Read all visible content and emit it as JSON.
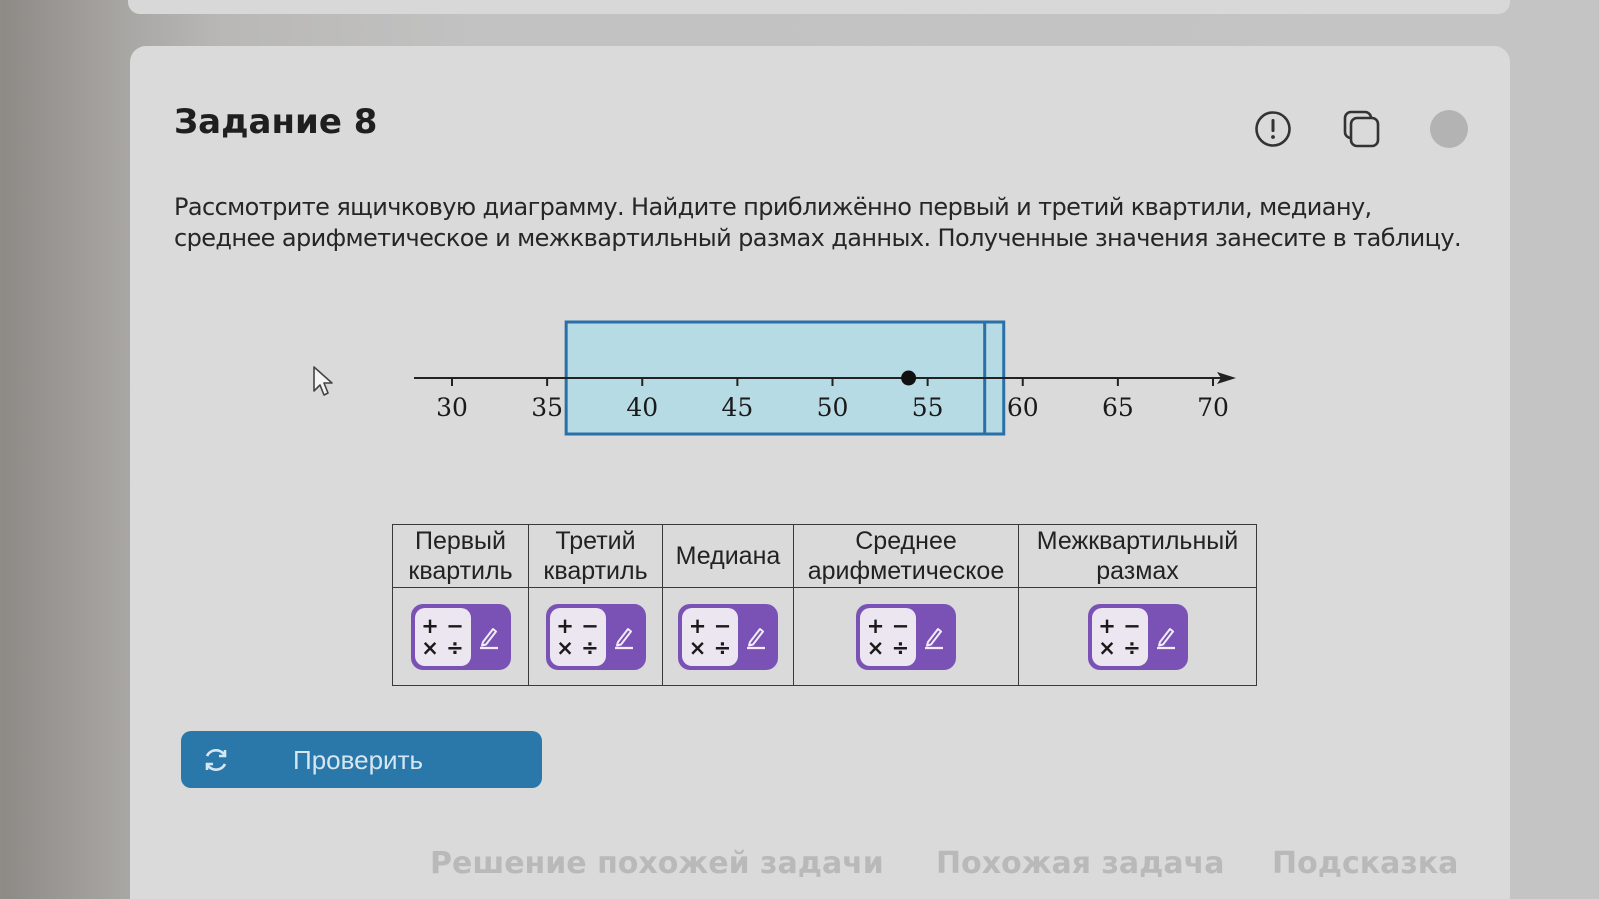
{
  "task": {
    "title": "Задание 8",
    "prompt_line1": "Рассмотрите ящичковую диаграмму. Найдите приближённо первый и третий квартили, медиану,",
    "prompt_line2": "среднее арифметическое и межквартильный размах данных. Полученные значения занесите в таблицу."
  },
  "icons": {
    "info": "exclamation-circle-icon",
    "copy": "copy-icon",
    "status": "status-dot-icon"
  },
  "chart_data": {
    "type": "boxplot",
    "x_ticks": [
      30,
      35,
      40,
      45,
      50,
      55,
      60,
      65,
      70
    ],
    "x_range": [
      28,
      72
    ],
    "box_q1": 36,
    "box_q3": 59,
    "median_line": 58,
    "mean_point": 54,
    "box_color": "#b6dbe4",
    "box_border_color": "#2b6fa8"
  },
  "table": {
    "headers": [
      {
        "line1": "Первый",
        "line2": "квартиль"
      },
      {
        "line1": "Третий",
        "line2": "квартиль"
      },
      {
        "line1": "Медиана",
        "line2": ""
      },
      {
        "line1": "Среднее",
        "line2": "арифметическое"
      },
      {
        "line1": "Межквартильный",
        "line2": "размах"
      }
    ],
    "input_ops_top": "+ −",
    "input_ops_bottom": "× ÷"
  },
  "check_button": {
    "label": "Проверить"
  },
  "bottom_links": {
    "similar_solution": "Решение похожей задачи",
    "similar_task": "Похожая задача",
    "hint": "Подсказка"
  },
  "colors": {
    "accent_purple": "#7a52b6",
    "check_blue": "#2a78a9"
  }
}
